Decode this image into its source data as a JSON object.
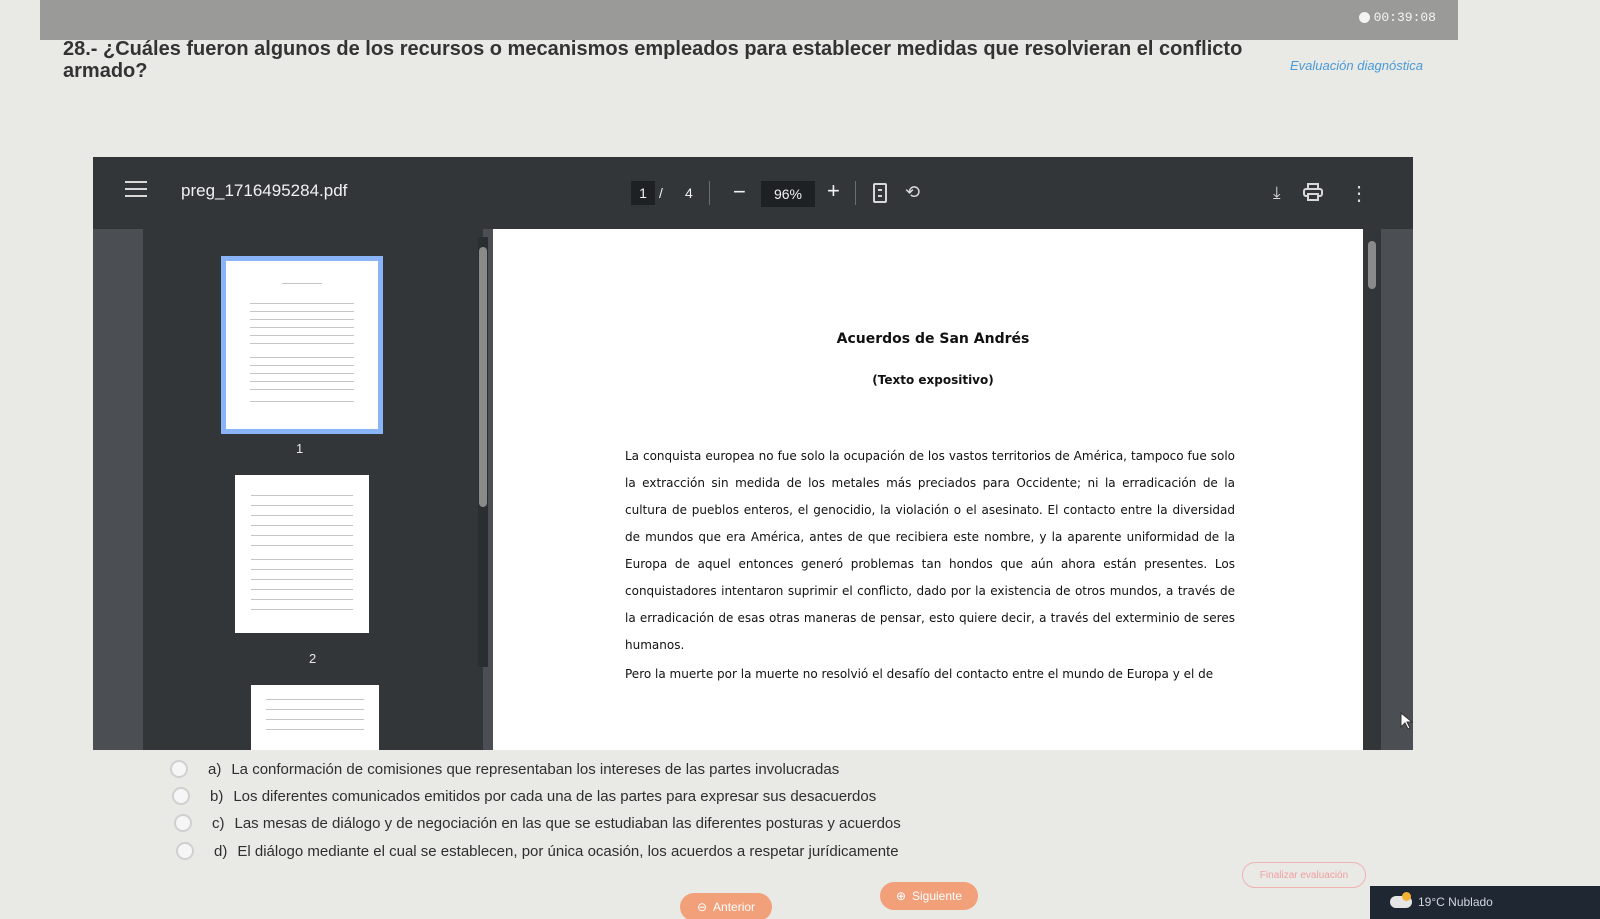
{
  "header": {
    "timer": "00:39:08",
    "question": "28.- ¿Cuáles fueron algunos de los recursos o mecanismos empleados para establecer medidas que resolvieran el conflicto armado?",
    "eval_tag": "Evaluación diagnóstica"
  },
  "viewer": {
    "filename": "preg_1716495284.pdf",
    "page_current": "1",
    "page_sep": "/",
    "page_total": "4",
    "zoom": "96%",
    "zoom_minus": "−",
    "zoom_plus": "+",
    "thumbnails": [
      "1",
      "2"
    ]
  },
  "document": {
    "title": "Acuerdos de San Andrés",
    "subtitle": "(Texto expositivo)",
    "paragraph1": "La conquista europea no fue solo la ocupación de los vastos territorios de América, tampoco fue solo la extracción sin medida de los metales más preciados para Occidente; ni la erradicación de la cultura de pueblos enteros, el genocidio, la violación o el asesinato. El contacto entre la diversidad de mundos que era América, antes de que recibiera este nombre, y la aparente uniformidad de la Europa de aquel entonces generó problemas tan hondos que aún ahora están presentes. Los conquistadores intentaron suprimir el conflicto, dado por la existencia de otros mundos, a través de la erradicación de esas otras maneras de pensar, esto quiere decir, a través del exterminio de seres humanos.",
    "paragraph2": "Pero la muerte por la muerte no resolvió el desafío del contacto entre el mundo de Europa y el de"
  },
  "options": [
    {
      "letter": "a)",
      "text": "La conformación de comisiones que representaban los intereses de las partes involucradas"
    },
    {
      "letter": "b)",
      "text": "Los diferentes comunicados emitidos por cada una de las partes para expresar sus desacuerdos"
    },
    {
      "letter": "c)",
      "text": "Las mesas de diálogo y de negociación en las que se estudiaban las diferentes posturas y acuerdos"
    },
    {
      "letter": "d)",
      "text": "El diálogo mediante el cual se establecen, por única ocasión, los acuerdos a respetar jurídicamente"
    }
  ],
  "nav": {
    "prev": "Anterior",
    "next": "Siguiente",
    "finish": "Finalizar evaluación"
  },
  "taskbar": {
    "weather": "19°C Nublado"
  }
}
